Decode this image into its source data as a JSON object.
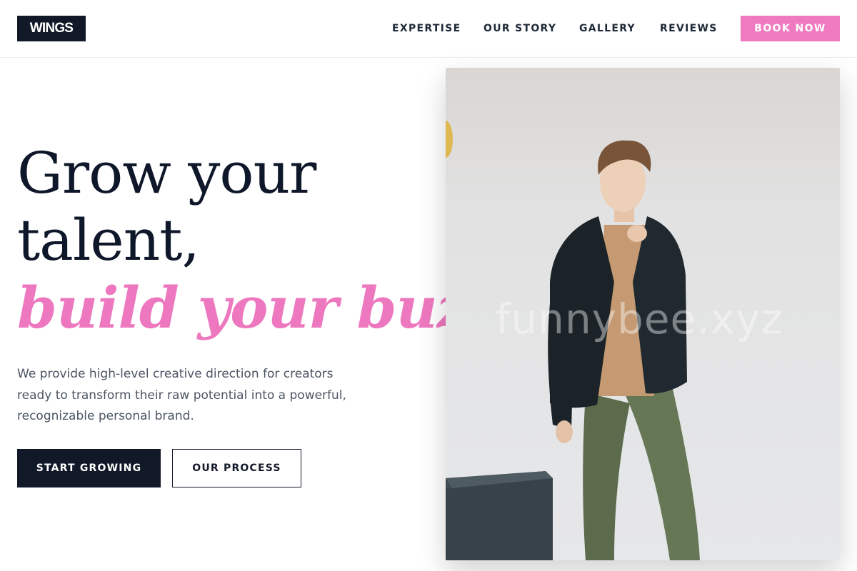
{
  "brand": {
    "logo_text": "WINGS"
  },
  "nav": {
    "items": [
      {
        "label": "EXPERTISE"
      },
      {
        "label": "OUR STORY"
      },
      {
        "label": "GALLERY"
      },
      {
        "label": "REVIEWS"
      }
    ],
    "cta_label": "BOOK NOW"
  },
  "hero": {
    "headline_line1": "Grow your",
    "headline_line2": "talent,",
    "headline_accent": "build your buzz.",
    "lead": "We provide high-level creative direction for creators ready to transform their raw potential into a powerful, recognizable personal brand.",
    "primary_cta": "START GROWING",
    "secondary_cta": "OUR PROCESS",
    "image_watermark": "funnybee.xyz"
  },
  "colors": {
    "accent": "#ee78bf",
    "dark": "#111827",
    "muted_text": "#4b5563"
  }
}
